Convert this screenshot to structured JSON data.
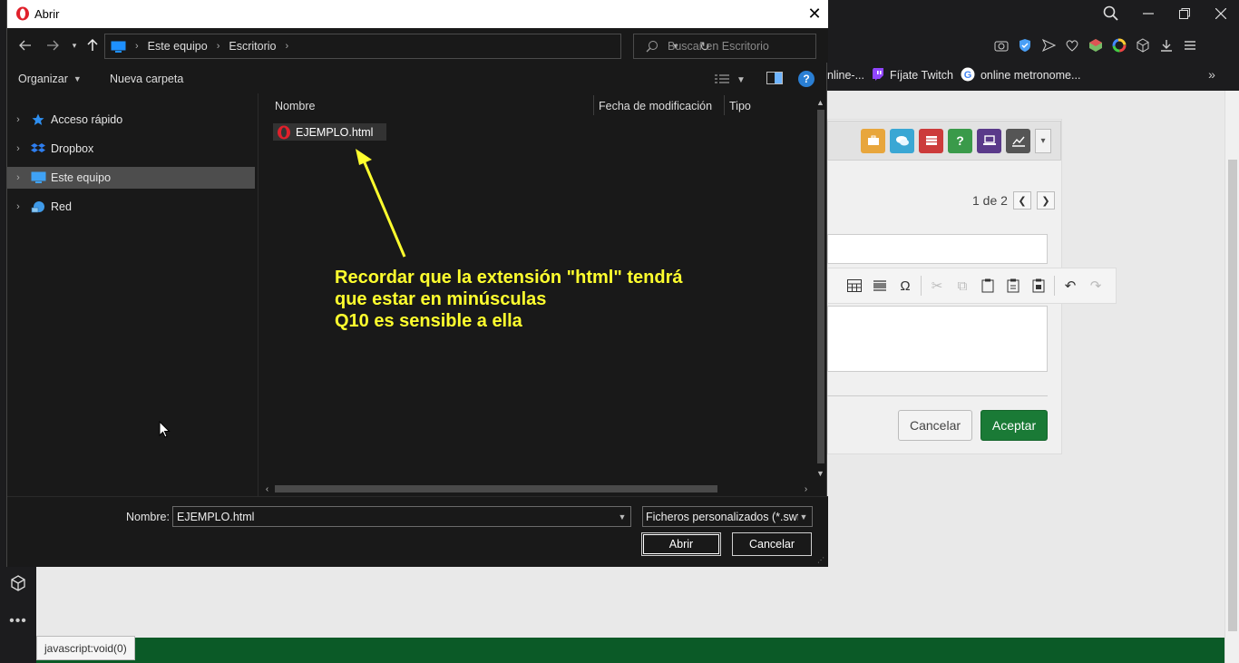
{
  "browser": {
    "bookmarks": [
      {
        "label": "nline-..."
      },
      {
        "label": "Fíjate Twitch"
      },
      {
        "label": "online metronome..."
      }
    ],
    "status_tip": "javascript:void(0)"
  },
  "background_page": {
    "pager_text": "1 de 2",
    "cancel_label": "Cancelar",
    "accept_label": "Aceptar"
  },
  "dialog": {
    "title": "Abrir",
    "breadcrumb": [
      "Este equipo",
      "Escritorio"
    ],
    "search_placeholder": "Buscar en Escritorio",
    "organize_label": "Organizar",
    "new_folder_label": "Nueva carpeta",
    "nav_items": [
      {
        "label": "Acceso rápido",
        "icon": "star-icon"
      },
      {
        "label": "Dropbox",
        "icon": "dropbox-icon"
      },
      {
        "label": "Este equipo",
        "icon": "computer-icon",
        "selected": true
      },
      {
        "label": "Red",
        "icon": "network-icon"
      }
    ],
    "columns": {
      "name": "Nombre",
      "modified": "Fecha de modificación",
      "type": "Tipo"
    },
    "files": [
      {
        "name": "EJEMPLO.html",
        "icon": "opera-icon"
      }
    ],
    "name_label": "Nombre:",
    "name_value": "EJEMPLO.html",
    "filter_value": "Ficheros personalizados (*.swf;*",
    "open_label": "Abrir",
    "cancel_label": "Cancelar"
  },
  "annotation": {
    "lines": [
      "Recordar que la extensión \"html\" tendrá",
      "que estar en minúsculas",
      "Q10 es sensible a ella"
    ],
    "color": "#ffff2e"
  },
  "colors": {
    "dialog_bg": "#191919",
    "selection": "#4d4d4d",
    "accent_green": "#1a7a36",
    "opera_red": "#e0202b"
  }
}
